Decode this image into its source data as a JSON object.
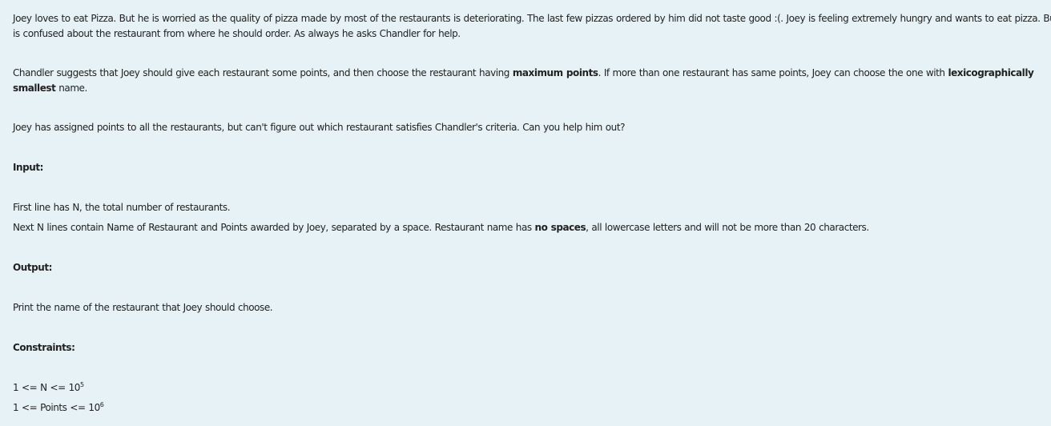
{
  "problem": {
    "intro": {
      "line1": "Joey loves to eat Pizza. But he is worried as the quality of pizza made by most of the restaurants is deteriorating. The last few pizzas ordered by him did not taste good :(. Joey is feeling extremely hungry and wants to eat pizza. But he",
      "line2": "is confused about the restaurant from where he should order. As always he asks Chandler for help."
    },
    "suggestion": {
      "part1": "Chandler suggests that Joey should give each restaurant some points, and then choose the restaurant having ",
      "bold1": "maximum points",
      "part2": ". If more than one restaurant has same points, Joey can choose the one with ",
      "bold2a": "lexicographically",
      "bold2b": "smallest",
      "part3": " name."
    },
    "question": "Joey has assigned points to all the restaurants, but can't figure out which restaurant satisfies Chandler's criteria. Can you help him out?",
    "input_heading": "Input:",
    "input_line1": "First line has N, the total number of restaurants.",
    "input_line2": {
      "part1": "Next N lines contain Name of Restaurant and Points awarded by Joey, separated by a space. Restaurant name has ",
      "bold": "no spaces",
      "part2": ", all lowercase letters and will not be more than 20 characters."
    },
    "output_heading": "Output:",
    "output_text": "Print the name of the restaurant that Joey should choose.",
    "constraints_heading": "Constraints:",
    "constraint1": {
      "text": "1 <= N <= 10",
      "exponent": "5"
    },
    "constraint2": {
      "text": "1 <= Points <= 10",
      "exponent": "6"
    }
  }
}
